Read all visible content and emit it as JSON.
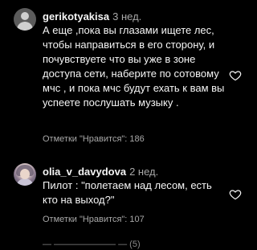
{
  "comments": [
    {
      "username": "gerikotyakisa",
      "time": "3 нед.",
      "text": "А еще ,пока вы глазами ищете лес, чтобы направиться в его сторону, и почувствуете что вы уже в зоне доступа сети, наберите по сотовому мчс , и пока мчс будут ехать к вам вы успеете послушать музыку .",
      "likes_label": "Отметки \"Нравится\":",
      "likes_count": "186"
    },
    {
      "username": "olia_v_davydova",
      "time": "2 нед.",
      "text": "Пилот : \"полетаем над лесом, есть кто на выход?\"",
      "likes_label": "Отметки \"Нравится\":",
      "likes_count": "107"
    }
  ],
  "partial_line": "— ——————— — (5)",
  "icons": {
    "like": "heart-outline-icon",
    "avatar": "avatar-icon"
  },
  "colors": {
    "background": "#000000",
    "primary_text": "#f5f5f5",
    "secondary_text": "#a8a8a8"
  }
}
